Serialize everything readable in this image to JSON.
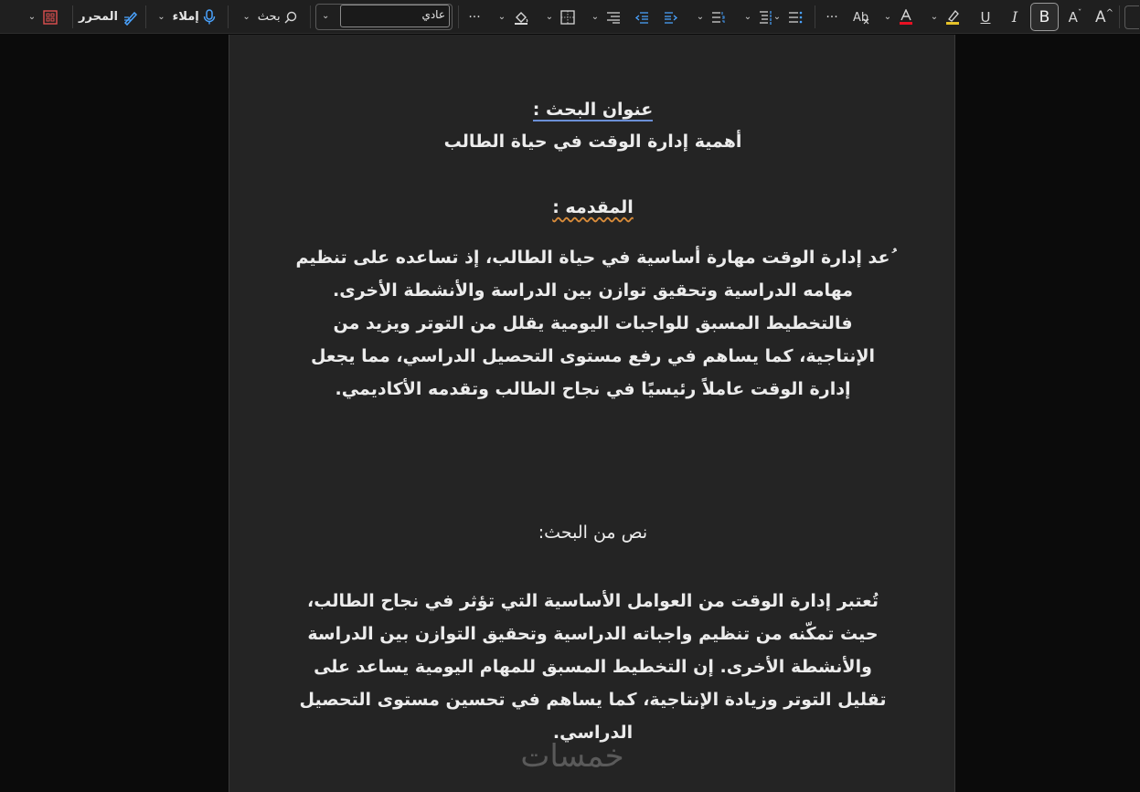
{
  "toolbar": {
    "editor_label": "المحرر",
    "dictate_label": "إملاء",
    "search_label": "بحث",
    "style_value": "عادي",
    "bold_label": "B",
    "italic_label": "I",
    "underline_label": "U",
    "more_label": "···",
    "grow_font_label": "A",
    "shrink_font_label": "A",
    "font_color": "#e81123"
  },
  "document": {
    "title_heading": "عنوان البحث :",
    "title": "أهمية إدارة الوقت في حياة الطالب",
    "intro_heading": "المقدمه :",
    "intro_lines": [
      "ُعد إدارة الوقت مهارة أساسية في حياة الطالب، إذ تساعده على تنظيم",
      "مهامه الدراسية وتحقيق توازن بين الدراسة والأنشطة الأخرى.",
      "فالتخطيط المسبق للواجبات اليومية يقلل من التوتر ويزيد من",
      "الإنتاجية، كما يساهم في رفع مستوى التحصيل الدراسي، مما يجعل",
      "إدارة الوقت عاملاً رئيسيًا في نجاح الطالب وتقدمه الأكاديمي."
    ],
    "body_heading": "نص من البحث:",
    "body_lines": [
      "تُعتبر إدارة الوقت من العوامل الأساسية التي تؤثر في نجاح الطالب،",
      "حيث تمكّنه من تنظيم واجباته الدراسية وتحقيق التوازن بين الدراسة",
      "والأنشطة الأخرى. إن التخطيط المسبق للمهام اليومية يساعد على",
      "تقليل التوتر وزيادة الإنتاجية، كما يساهم في تحسين مستوى التحصيل",
      "الدراسي."
    ]
  },
  "watermark": "خمسات"
}
